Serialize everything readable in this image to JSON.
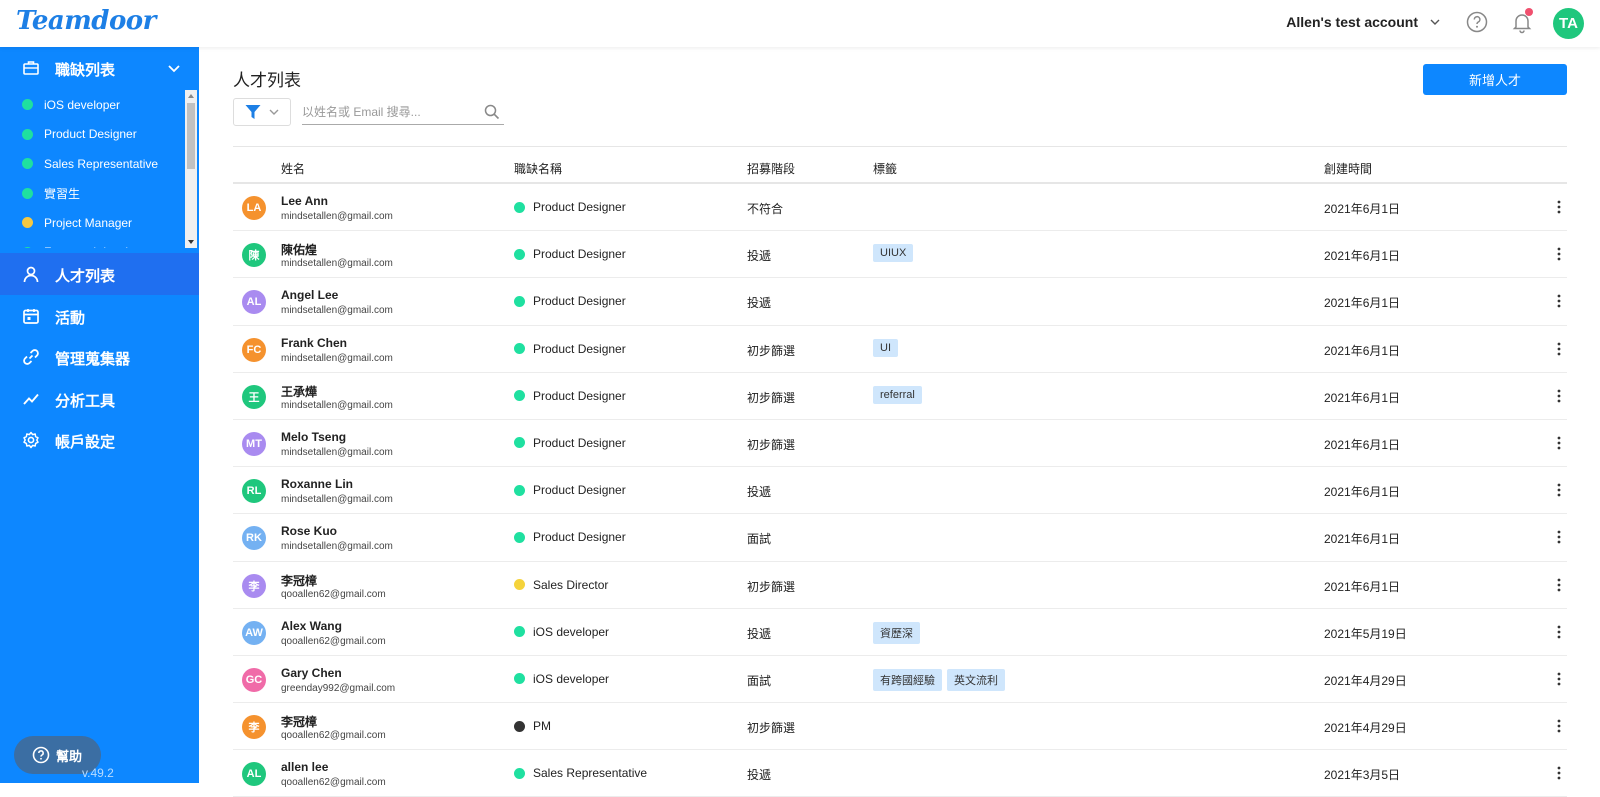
{
  "app": {
    "logo": "Teamdoor"
  },
  "topbar": {
    "account": "Allen's test account",
    "avatar_initials": "TA"
  },
  "sidebar": {
    "section_title": "職缺列表",
    "jobs": [
      {
        "label": "iOS developer",
        "color": "#1fe0a0"
      },
      {
        "label": "Product Designer",
        "color": "#1fe0a0"
      },
      {
        "label": "Sales Representative",
        "color": "#1fe0a0"
      },
      {
        "label": "實習生",
        "color": "#1fe0a0"
      },
      {
        "label": "Project Manager",
        "color": "#f5c842"
      },
      {
        "label": "Front-end developer",
        "color": "#1fe0a0"
      }
    ],
    "nav": [
      {
        "label": "人才列表",
        "icon": "person-icon",
        "active": true
      },
      {
        "label": "活動",
        "icon": "calendar-icon",
        "active": false
      },
      {
        "label": "管理蒐集器",
        "icon": "link-icon",
        "active": false
      },
      {
        "label": "分析工具",
        "icon": "chart-icon",
        "active": false
      },
      {
        "label": "帳戶設定",
        "icon": "gear-icon",
        "active": false
      }
    ],
    "help_label": "幫助",
    "version": "v.49.2"
  },
  "main": {
    "title": "人才列表",
    "add_button": "新增人才",
    "search_placeholder": "以姓名或 Email 搜尋...",
    "columns": {
      "name": "姓名",
      "job": "職缺名稱",
      "stage": "招募階段",
      "tags": "標籤",
      "created": "創建時間"
    },
    "rows": [
      {
        "initials": "LA",
        "avatar_color": "#f5922e",
        "name": "Lee Ann",
        "email": "mindsetallen@gmail.com",
        "job": "Product Designer",
        "job_color": "#1fe0a0",
        "stage": "不符合",
        "tags": [],
        "created": "2021年6月1日"
      },
      {
        "initials": "陳",
        "avatar_color": "#1fc77d",
        "name": "陳佑煌",
        "email": "mindsetallen@gmail.com",
        "job": "Product Designer",
        "job_color": "#1fe0a0",
        "stage": "投遞",
        "tags": [
          "UIUX"
        ],
        "created": "2021年6月1日"
      },
      {
        "initials": "AL",
        "avatar_color": "#a98bf0",
        "name": "Angel Lee",
        "email": "mindsetallen@gmail.com",
        "job": "Product Designer",
        "job_color": "#1fe0a0",
        "stage": "投遞",
        "tags": [],
        "created": "2021年6月1日"
      },
      {
        "initials": "FC",
        "avatar_color": "#f5922e",
        "name": "Frank Chen",
        "email": "mindsetallen@gmail.com",
        "job": "Product Designer",
        "job_color": "#1fe0a0",
        "stage": "初步篩選",
        "tags": [
          "UI"
        ],
        "created": "2021年6月1日"
      },
      {
        "initials": "王",
        "avatar_color": "#1fc77d",
        "name": "王承燁",
        "email": "mindsetallen@gmail.com",
        "job": "Product Designer",
        "job_color": "#1fe0a0",
        "stage": "初步篩選",
        "tags": [
          "referral"
        ],
        "created": "2021年6月1日"
      },
      {
        "initials": "MT",
        "avatar_color": "#a98bf0",
        "name": "Melo Tseng",
        "email": "mindsetallen@gmail.com",
        "job": "Product Designer",
        "job_color": "#1fe0a0",
        "stage": "初步篩選",
        "tags": [],
        "created": "2021年6月1日"
      },
      {
        "initials": "RL",
        "avatar_color": "#1fc77d",
        "name": "Roxanne Lin",
        "email": "mindsetallen@gmail.com",
        "job": "Product Designer",
        "job_color": "#1fe0a0",
        "stage": "投遞",
        "tags": [],
        "created": "2021年6月1日"
      },
      {
        "initials": "RK",
        "avatar_color": "#74b1f2",
        "name": "Rose Kuo",
        "email": "mindsetallen@gmail.com",
        "job": "Product Designer",
        "job_color": "#1fe0a0",
        "stage": "面試",
        "tags": [],
        "created": "2021年6月1日"
      },
      {
        "initials": "李",
        "avatar_color": "#a98bf0",
        "name": "李冠樟",
        "email": "qooallen62@gmail.com",
        "job": "Sales Director",
        "job_color": "#f5d33b",
        "stage": "初步篩選",
        "tags": [],
        "created": "2021年6月1日"
      },
      {
        "initials": "AW",
        "avatar_color": "#74b1f2",
        "name": "Alex Wang",
        "email": "qooallen62@gmail.com",
        "job": "iOS developer",
        "job_color": "#1fe0a0",
        "stage": "投遞",
        "tags": [
          "資歷深"
        ],
        "created": "2021年5月19日"
      },
      {
        "initials": "GC",
        "avatar_color": "#f06ba8",
        "name": "Gary Chen",
        "email": "greenday992@gmail.com",
        "job": "iOS developer",
        "job_color": "#1fe0a0",
        "stage": "面試",
        "tags": [
          "有跨國經驗",
          "英文流利"
        ],
        "created": "2021年4月29日"
      },
      {
        "initials": "李",
        "avatar_color": "#f5922e",
        "name": "李冠樟",
        "email": "qooallen62@gmail.com",
        "job": "PM",
        "job_color": "#333333",
        "stage": "初步篩選",
        "tags": [],
        "created": "2021年4月29日"
      },
      {
        "initials": "AL",
        "avatar_color": "#1fc77d",
        "name": "allen lee",
        "email": "qooallen62@gmail.com",
        "job": "Sales Representative",
        "job_color": "#1fe0a0",
        "stage": "投遞",
        "tags": [],
        "created": "2021年3月5日"
      }
    ]
  }
}
